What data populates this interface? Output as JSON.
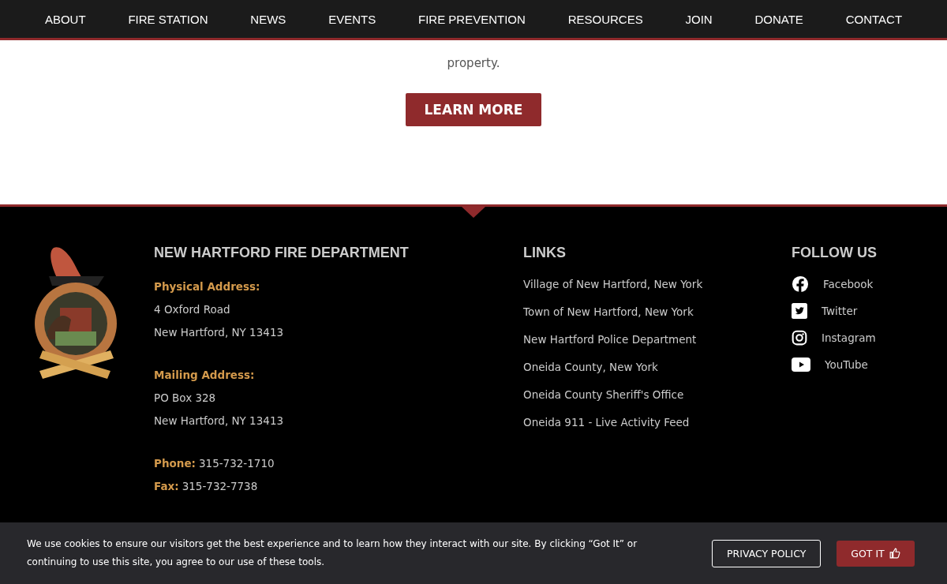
{
  "nav": [
    {
      "label": "ABOUT"
    },
    {
      "label": "FIRE STATION"
    },
    {
      "label": "NEWS"
    },
    {
      "label": "EVENTS"
    },
    {
      "label": "FIRE PREVENTION"
    },
    {
      "label": "RESOURCES"
    },
    {
      "label": "JOIN"
    },
    {
      "label": "DONATE"
    },
    {
      "label": "CONTACT"
    }
  ],
  "intro": {
    "text": "property.",
    "button": "LEARN MORE"
  },
  "footer": {
    "department": {
      "title": "NEW HARTFORD FIRE DEPARTMENT",
      "blocks": [
        {
          "label": "Physical Address:",
          "lines": [
            "4 Oxford Road",
            "New Hartford, NY 13413"
          ]
        },
        {
          "label": "Mailing Address:",
          "lines": [
            "PO Box 328",
            "New Hartford, NY 13413"
          ]
        }
      ],
      "contacts": [
        {
          "label": "Phone:",
          "value": "315-732-1710"
        },
        {
          "label": "Fax:",
          "value": "315-732-7738"
        }
      ]
    },
    "links": {
      "title": "LINKS",
      "items": [
        "Village of New Hartford, New York",
        "Town of New Hartford, New York",
        "New Hartford Police Department",
        "Oneida County, New York",
        "Oneida County Sheriff's Office",
        "Oneida 911 - Live Activity Feed"
      ]
    },
    "follow": {
      "title": "FOLLOW US",
      "items": [
        {
          "kind": "facebook",
          "label": "Facebook"
        },
        {
          "kind": "twitter",
          "label": "Twitter"
        },
        {
          "kind": "instagram",
          "label": "Instagram"
        },
        {
          "kind": "youtube",
          "label": "YouTube"
        }
      ]
    }
  },
  "cookie_banner": {
    "text": "We use cookies to ensure our visitors get the best experience and to learn how they interact with our site. By clicking “Got It” or continuing to use this site, you agree to our use of these tools.",
    "policy_button": "PRIVACY POLICY",
    "accept_button": "GOT IT"
  }
}
